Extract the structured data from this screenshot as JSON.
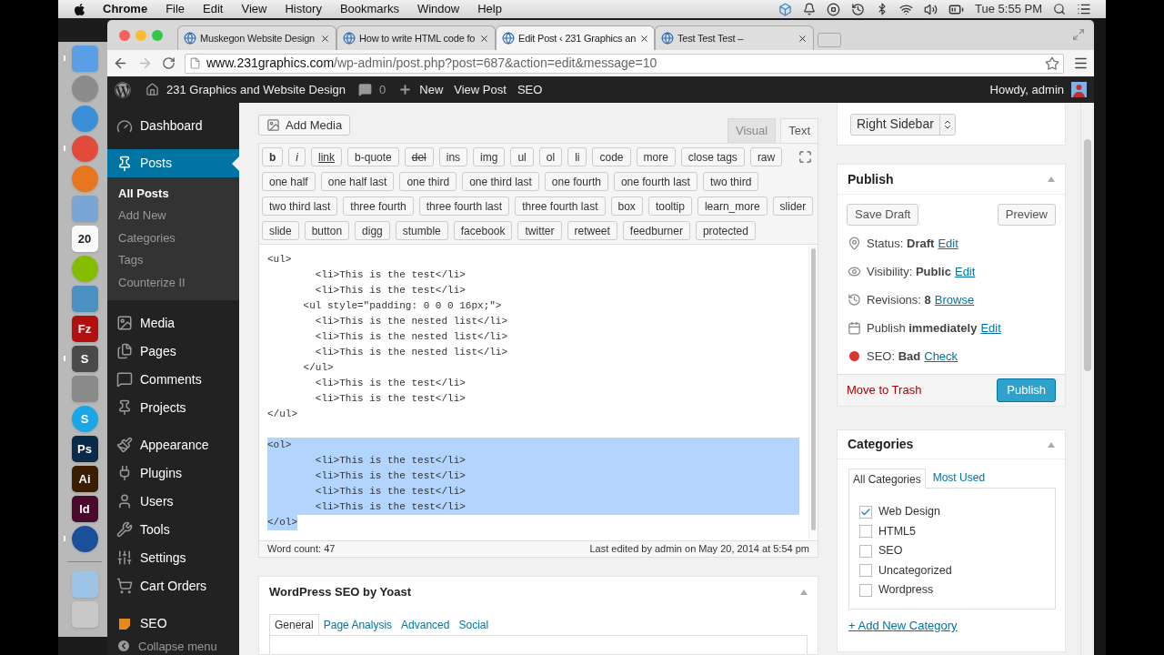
{
  "menu_bar": {
    "app": "Chrome",
    "menus": [
      "File",
      "Edit",
      "View",
      "History",
      "Bookmarks",
      "Window",
      "Help"
    ],
    "clock": "Tue 5:55 PM"
  },
  "dock_apps": [
    {
      "kind": "square",
      "color": "#5a9fe6",
      "running": true
    },
    {
      "kind": "round",
      "color": "#8c8c8c",
      "running": false
    },
    {
      "kind": "round",
      "color": "#3a8fd8",
      "running": false
    },
    {
      "kind": "round",
      "color": "#e04b3c",
      "running": true
    },
    {
      "kind": "round",
      "color": "#e8761f",
      "running": false
    },
    {
      "kind": "square",
      "color": "#7aa6d6",
      "running": false
    },
    {
      "kind": "square",
      "color": "#fafafa",
      "running": false,
      "label": "20"
    },
    {
      "kind": "round",
      "color": "#84bd00",
      "running": false
    },
    {
      "kind": "square",
      "color": "#4a90c0",
      "running": false
    },
    {
      "kind": "square",
      "color": "#b01010",
      "running": false,
      "label": "Fz"
    },
    {
      "kind": "square",
      "color": "#4a4a4a",
      "running": true,
      "label": "S"
    },
    {
      "kind": "square",
      "color": "#8a8a8a",
      "running": false
    },
    {
      "kind": "round",
      "color": "#1ba6e8",
      "running": false,
      "label": "S"
    },
    {
      "kind": "square",
      "color": "#0b2a4a",
      "running": false,
      "label": "Ps"
    },
    {
      "kind": "square",
      "color": "#3b1d00",
      "running": false,
      "label": "Ai"
    },
    {
      "kind": "square",
      "color": "#4a0a2c",
      "running": false,
      "label": "Id"
    },
    {
      "kind": "round",
      "color": "#1a4f9a",
      "running": true
    }
  ],
  "dock_stacks": [
    {
      "kind": "square",
      "color": "#9dc3e6",
      "running": false
    },
    {
      "kind": "square",
      "color": "#c8c8c8",
      "running": false
    }
  ],
  "tabs": [
    {
      "title": "Muskegon Website Design",
      "selected": false
    },
    {
      "title": "How to write HTML code fo",
      "selected": false
    },
    {
      "title": "Edit Post ‹ 231 Graphics an",
      "selected": true
    },
    {
      "title": "Test Test Test –",
      "selected": false
    }
  ],
  "address": {
    "host": "www.231graphics.com",
    "path": "/wp-admin/post.php?post=687&action=edit&message=10"
  },
  "admin_bar": {
    "site": "231 Graphics and Website Design",
    "comments": "0",
    "new": "New",
    "links": [
      "View Post",
      "SEO"
    ],
    "greeting": "Howdy, admin"
  },
  "sidebar": {
    "groups": [
      [
        {
          "label": "Dashboard",
          "selected": false
        }
      ],
      [
        {
          "label": "Posts",
          "selected": true,
          "children": [
            {
              "label": "All Posts",
              "selected": true
            },
            {
              "label": "Add New",
              "selected": false
            },
            {
              "label": "Categories",
              "selected": false
            },
            {
              "label": "Tags",
              "selected": false
            },
            {
              "label": "Counterize II",
              "selected": false
            }
          ]
        }
      ],
      [
        {
          "label": "Media",
          "selected": false
        },
        {
          "label": "Pages",
          "selected": false
        },
        {
          "label": "Comments",
          "selected": false
        },
        {
          "label": "Projects",
          "selected": false
        }
      ],
      [
        {
          "label": "Appearance",
          "selected": false
        },
        {
          "label": "Plugins",
          "selected": false
        },
        {
          "label": "Users",
          "selected": false
        },
        {
          "label": "Tools",
          "selected": false
        },
        {
          "label": "Settings",
          "selected": false
        },
        {
          "label": "Cart Orders",
          "selected": false
        }
      ],
      [
        {
          "label": "SEO",
          "selected": false
        }
      ]
    ],
    "collapse": "Collapse menu"
  },
  "editor": {
    "add_media": "Add Media",
    "modes": [
      {
        "label": "Visual",
        "selected": false
      },
      {
        "label": "Text",
        "selected": true
      }
    ],
    "quicktags": [
      [
        {
          "label": "b",
          "kind": "bold"
        },
        {
          "label": "i",
          "kind": "italic"
        },
        {
          "label": "link",
          "kind": "underline"
        },
        {
          "label": "b-quote",
          "kind": "plain"
        },
        {
          "label": "del",
          "kind": "strike"
        },
        {
          "label": "ins",
          "kind": "plain"
        },
        {
          "label": "img",
          "kind": "plain"
        },
        {
          "label": "ul",
          "kind": "plain"
        },
        {
          "label": "ol",
          "kind": "plain"
        },
        {
          "label": "li",
          "kind": "plain"
        },
        {
          "label": "code",
          "kind": "plain"
        },
        {
          "label": "more",
          "kind": "plain"
        },
        {
          "label": "close tags",
          "kind": "plain"
        },
        {
          "label": "raw",
          "kind": "plain"
        }
      ],
      [
        {
          "label": "one half",
          "kind": "plain"
        },
        {
          "label": "one half last",
          "kind": "plain"
        },
        {
          "label": "one third",
          "kind": "plain"
        },
        {
          "label": "one third last",
          "kind": "plain"
        },
        {
          "label": "one fourth",
          "kind": "plain"
        },
        {
          "label": "one fourth last",
          "kind": "plain"
        },
        {
          "label": "two third",
          "kind": "plain"
        }
      ],
      [
        {
          "label": "two third last",
          "kind": "plain"
        },
        {
          "label": "three fourth",
          "kind": "plain"
        },
        {
          "label": "three fourth last",
          "kind": "plain"
        },
        {
          "label": "three fourth last",
          "kind": "plain"
        },
        {
          "label": "box",
          "kind": "plain"
        },
        {
          "label": "tooltip",
          "kind": "plain"
        },
        {
          "label": "learn_more",
          "kind": "plain"
        },
        {
          "label": "slider",
          "kind": "plain"
        }
      ],
      [
        {
          "label": "slide",
          "kind": "plain"
        },
        {
          "label": "button",
          "kind": "plain"
        },
        {
          "label": "digg",
          "kind": "plain"
        },
        {
          "label": "stumble",
          "kind": "plain"
        },
        {
          "label": "facebook",
          "kind": "plain"
        },
        {
          "label": "twitter",
          "kind": "plain"
        },
        {
          "label": "retweet",
          "kind": "plain"
        },
        {
          "label": "feedburner",
          "kind": "plain"
        },
        {
          "label": "protected",
          "kind": "plain"
        }
      ]
    ],
    "code_blocks": [
      {
        "selected": false,
        "lines": [
          "<ul>",
          "        <li>This is the test</li>",
          "        <li>This is the test</li>",
          "      <ul style=\"padding: 0 0 0 16px;\">",
          "        <li>This is the nested list</li>",
          "        <li>This is the nested list</li>",
          "        <li>This is the nested list</li>",
          "      </ul>",
          "        <li>This is the test</li>",
          "        <li>This is the test</li>",
          "</ul>"
        ]
      },
      {
        "selected": true,
        "lines": [
          "<ol>",
          "        <li>This is the test</li>",
          "        <li>This is the test</li>",
          "        <li>This is the test</li>",
          "        <li>This is the test</li>",
          "</ol>"
        ]
      }
    ],
    "word_count": "Word count: 47",
    "last_edited": "Last edited by admin on May 20, 2014 at 5:54 pm"
  },
  "yoast": {
    "title": "WordPress SEO by Yoast",
    "tabs": [
      {
        "label": "General",
        "selected": true
      },
      {
        "label": "Page Analysis",
        "selected": false
      },
      {
        "label": "Advanced",
        "selected": false
      },
      {
        "label": "Social",
        "selected": false
      }
    ]
  },
  "template": {
    "value": "Right Sidebar"
  },
  "publish": {
    "title": "Publish",
    "save_draft": "Save Draft",
    "preview": "Preview",
    "rows": [
      {
        "text": "Status: **Draft**",
        "link": "Edit"
      },
      {
        "text": "Visibility: **Public**",
        "link": "Edit"
      },
      {
        "text": "Revisions: **8**",
        "link": "Browse"
      },
      {
        "text": "Publish **immediately**",
        "link": "Edit"
      },
      {
        "text": "SEO: **Bad**",
        "link": "Check",
        "color": "#dd3333"
      }
    ],
    "trash": "Move to Trash",
    "publish": "Publish"
  },
  "categories": {
    "title": "Categories",
    "tabs": [
      {
        "label": "All Categories",
        "selected": true
      },
      {
        "label": "Most Used",
        "selected": false
      }
    ],
    "items": [
      {
        "label": "Web Design",
        "checked": true
      },
      {
        "label": "HTML5",
        "checked": false
      },
      {
        "label": "SEO",
        "checked": false
      },
      {
        "label": "Uncategorized",
        "checked": false
      },
      {
        "label": "Wordpress",
        "checked": false
      }
    ],
    "add_new": "+ Add New Category"
  }
}
